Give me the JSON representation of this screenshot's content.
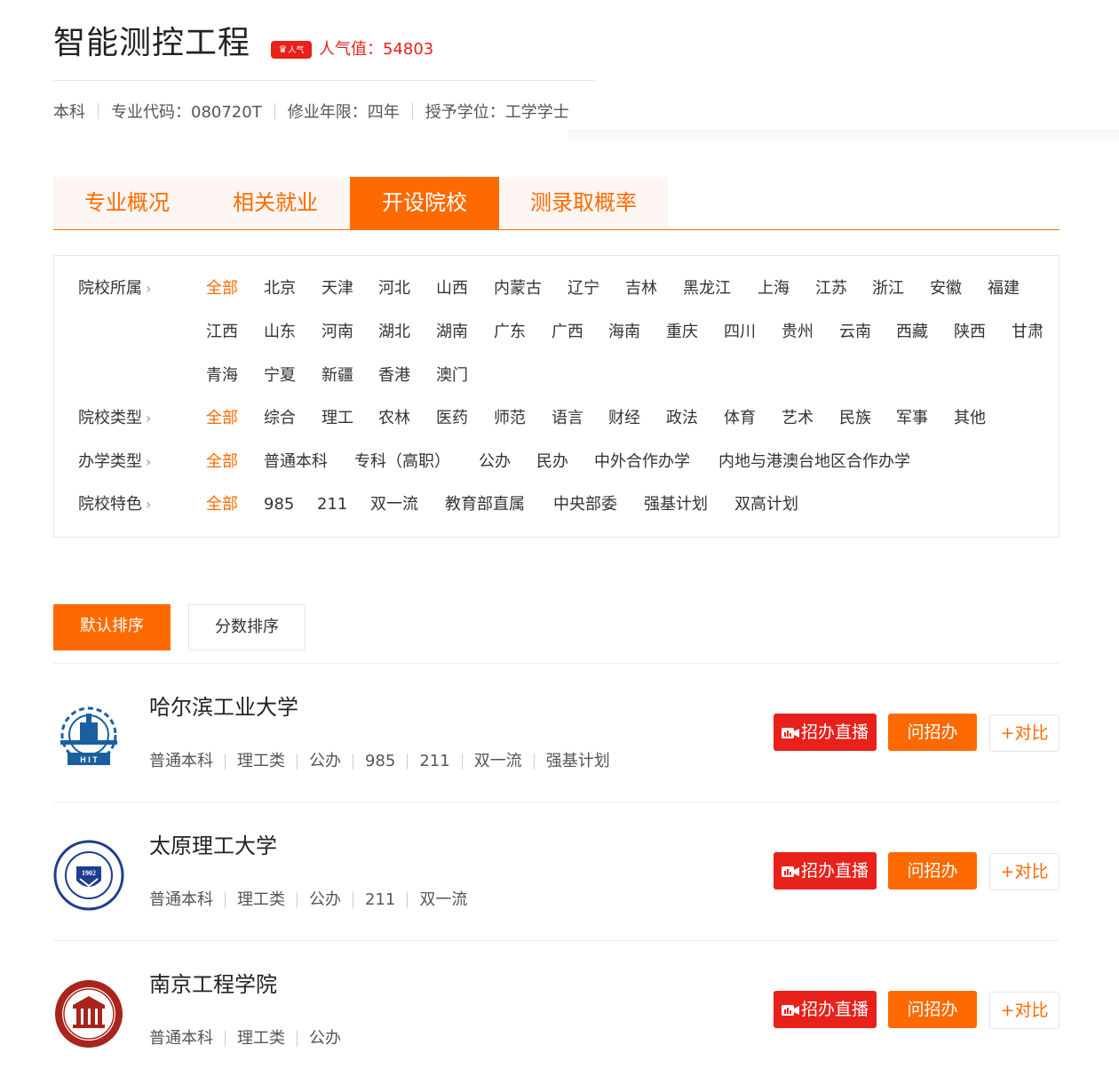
{
  "header": {
    "title": "智能测控工程",
    "hot_badge": "人气",
    "popularity_label": "人气值：54803",
    "meta": [
      "本科",
      "专业代码：080720T",
      "修业年限：四年",
      "授予学位：工学学士"
    ]
  },
  "tabs": [
    {
      "label": "专业概况",
      "active": false
    },
    {
      "label": "相关就业",
      "active": false
    },
    {
      "label": "开设院校",
      "active": true
    },
    {
      "label": "测录取概率",
      "active": false
    }
  ],
  "filters": {
    "region": {
      "label": "院校所属",
      "options": [
        "全部",
        "北京",
        "天津",
        "河北",
        "山西",
        "内蒙古",
        "辽宁",
        "吉林",
        "黑龙江",
        "上海",
        "江苏",
        "浙江",
        "安徽",
        "福建",
        "江西",
        "山东",
        "河南",
        "湖北",
        "湖南",
        "广东",
        "广西",
        "海南",
        "重庆",
        "四川",
        "贵州",
        "云南",
        "西藏",
        "陕西",
        "甘肃",
        "青海",
        "宁夏",
        "新疆",
        "香港",
        "澳门"
      ]
    },
    "type": {
      "label": "院校类型",
      "options": [
        "全部",
        "综合",
        "理工",
        "农林",
        "医药",
        "师范",
        "语言",
        "财经",
        "政法",
        "体育",
        "艺术",
        "民族",
        "军事",
        "其他"
      ]
    },
    "nature": {
      "label": "办学类型",
      "options": [
        "全部",
        "普通本科",
        "专科（高职）",
        "公办",
        "民办",
        "中外合作办学",
        "内地与港澳台地区合作办学"
      ]
    },
    "feature": {
      "label": "院校特色",
      "options": [
        "全部",
        "985",
        "211",
        "双一流",
        "教育部直属",
        "中央部委",
        "强基计划",
        "双高计划"
      ]
    }
  },
  "sort": {
    "default_label": "默认排序",
    "score_label": "分数排序"
  },
  "buttons": {
    "live": "招办直播",
    "ask": "问招办",
    "compare": "+对比"
  },
  "schools": [
    {
      "name": "哈尔滨工业大学",
      "tags": [
        "普通本科",
        "理工类",
        "公办",
        "985",
        "211",
        "双一流",
        "强基计划"
      ],
      "logo_icon": "hit-logo-icon"
    },
    {
      "name": "太原理工大学",
      "tags": [
        "普通本科",
        "理工类",
        "公办",
        "211",
        "双一流"
      ],
      "logo_icon": "tyut-logo-icon"
    },
    {
      "name": "南京工程学院",
      "tags": [
        "普通本科",
        "理工类",
        "公办"
      ],
      "logo_icon": "njit-logo-icon"
    }
  ],
  "colors": {
    "accent": "#ff6a00",
    "hot": "#e8211a",
    "tab_bg": "#fdf6f2"
  }
}
